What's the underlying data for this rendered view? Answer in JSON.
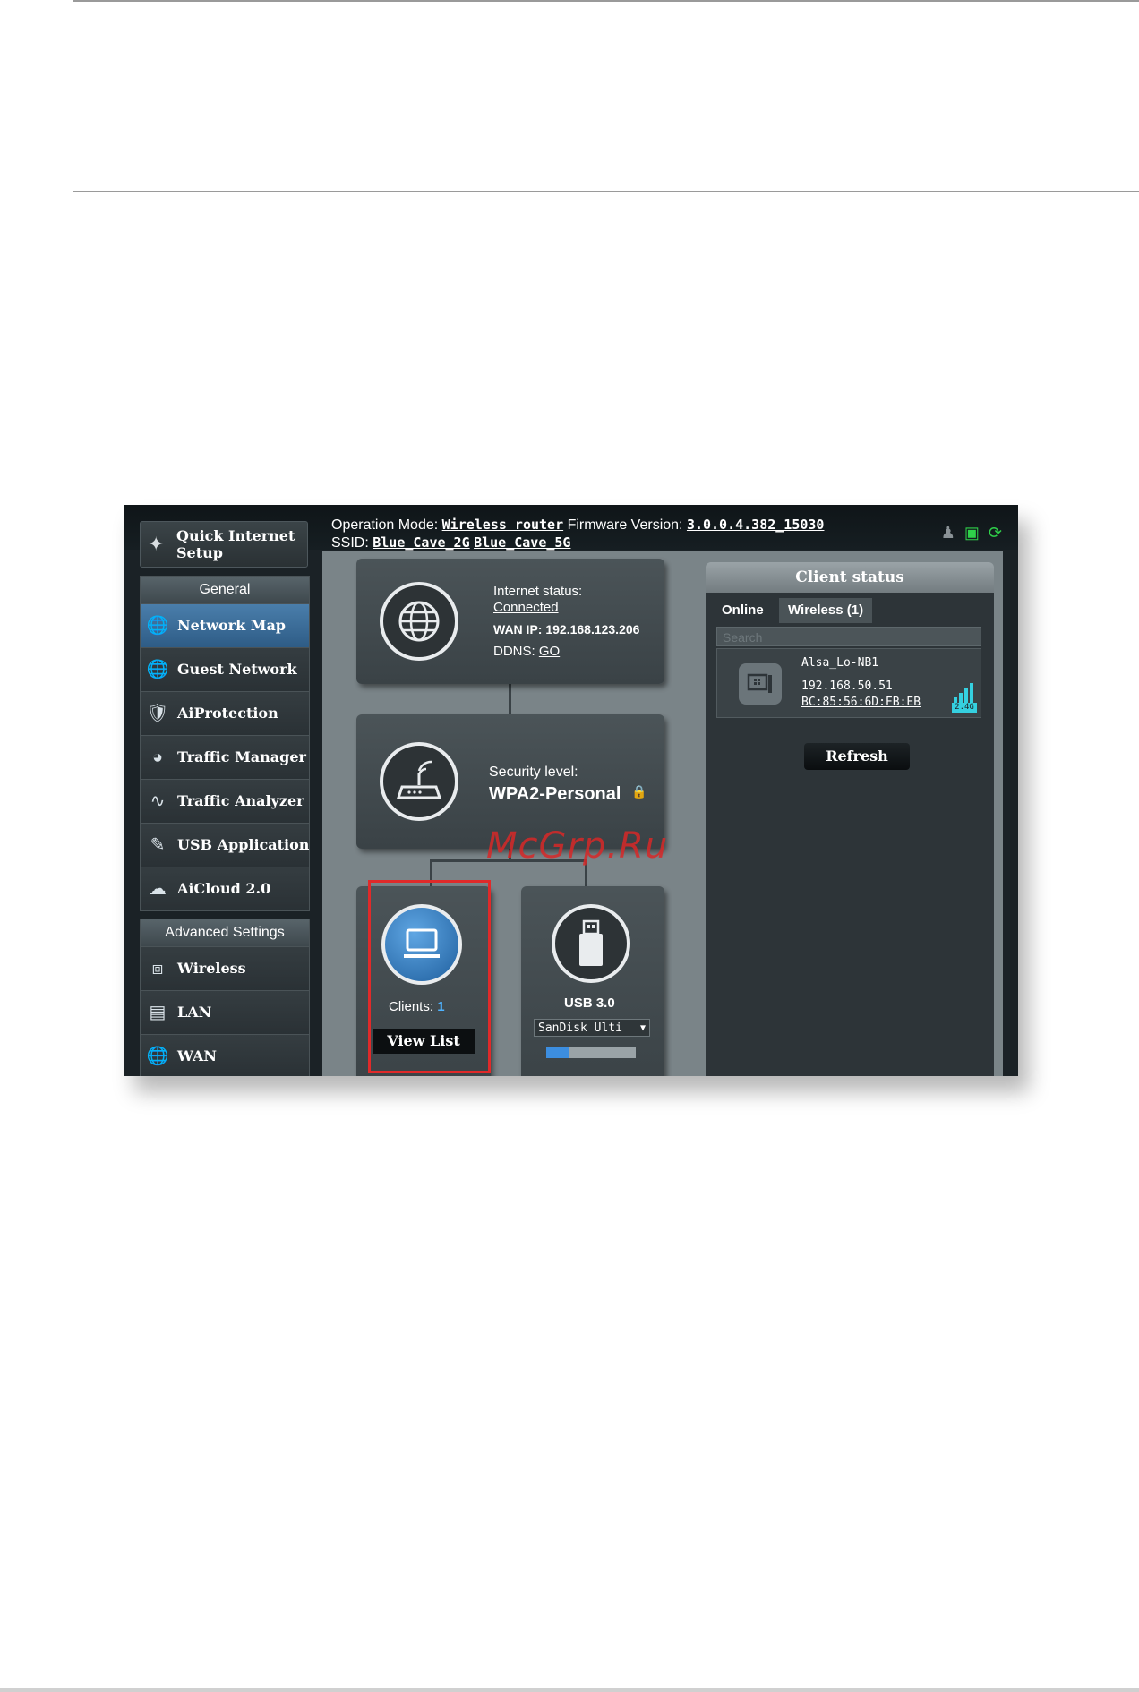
{
  "watermark": "McGrp.Ru",
  "header": {
    "op_mode_label": "Operation Mode:",
    "op_mode_value": "Wireless router",
    "firmware_label": "Firmware Version:",
    "firmware_value": "3.0.0.4.382_15030",
    "ssid_label": "SSID:",
    "ssid_2g": "Blue_Cave_2G",
    "ssid_5g": "Blue_Cave_5G"
  },
  "sidebar": {
    "quick_setup": "Quick Internet Setup",
    "general_header": "General",
    "general_items": [
      {
        "label": "Network Map",
        "icon": "network-map-icon"
      },
      {
        "label": "Guest Network",
        "icon": "guest-network-icon"
      },
      {
        "label": "AiProtection",
        "icon": "shield-icon"
      },
      {
        "label": "Traffic Manager",
        "icon": "gauge-icon"
      },
      {
        "label": "Traffic Analyzer",
        "icon": "pulse-icon"
      },
      {
        "label": "USB Application",
        "icon": "usb-app-icon"
      },
      {
        "label": "AiCloud 2.0",
        "icon": "cloud-icon"
      }
    ],
    "advanced_header": "Advanced Settings",
    "advanced_items": [
      {
        "label": "Wireless",
        "icon": "wireless-icon"
      },
      {
        "label": "LAN",
        "icon": "lan-icon"
      },
      {
        "label": "WAN",
        "icon": "globe-icon"
      }
    ]
  },
  "internet": {
    "status_label": "Internet status:",
    "status_value": "Connected",
    "wan_ip": "WAN IP: 192.168.123.206",
    "ddns_label": "DDNS:",
    "ddns_value": "GO"
  },
  "router": {
    "security_label": "Security level:",
    "security_value": "WPA2-Personal"
  },
  "clients": {
    "label": "Clients:",
    "count": "1",
    "view_list": "View List"
  },
  "usb": {
    "label": "USB 3.0",
    "device": "SanDisk Ulti",
    "usage_fraction": 0.25
  },
  "client_status": {
    "title": "Client status",
    "tab_online": "Online",
    "tab_wireless": "Wireless (1)",
    "search_placeholder": "Search",
    "client_name": "Alsa_Lo-NB1",
    "client_ip": "192.168.50.51",
    "client_mac": "BC:85:56:6D:FB:EB",
    "band": "2.4G",
    "refresh": "Refresh"
  },
  "colors": {
    "accent_blue": "#2e5c86",
    "highlight_red": "#e02a2a",
    "signal_cyan": "#35d0e0",
    "usb_green": "#2fd14a"
  }
}
